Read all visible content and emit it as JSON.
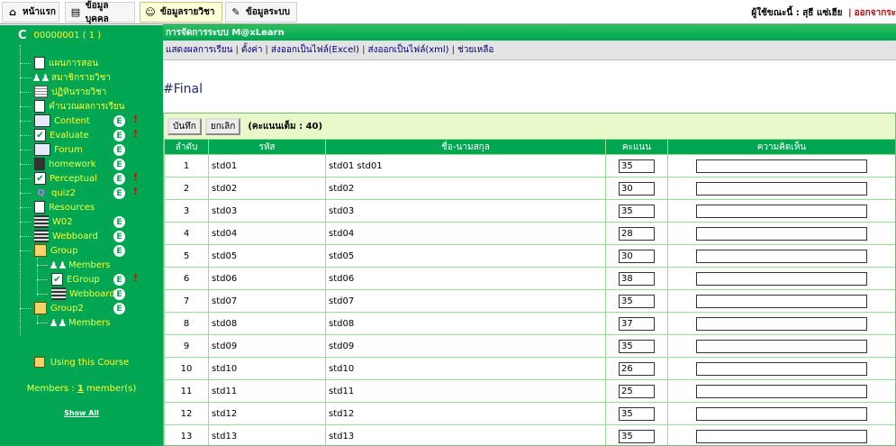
{
  "topbar": {
    "tabs": [
      {
        "label": "หน้าแรก",
        "icon": "home-icon"
      },
      {
        "label": "ข้อมูลบุคคล",
        "icon": "person-info-icon"
      },
      {
        "label": "ข้อมูลรายวิชา",
        "icon": "course-info-icon"
      },
      {
        "label": "ข้อมูลระบบ",
        "icon": "system-tools-icon"
      }
    ],
    "user_prefix": "ผู้ใช้ขณะนี้ : สุธี แซ่เฮีย",
    "separator": "|",
    "logout_label": "ออกจากระ"
  },
  "sidebar": {
    "course_icon": "C",
    "course_id": "00000001 ( 1 )",
    "items": [
      {
        "label": "แผนการสอน"
      },
      {
        "label": "สมาชิกรายวิชา"
      },
      {
        "label": "ปฏิทินรายวิชา"
      },
      {
        "label": "คำนวณผลการเรียน"
      },
      {
        "label": "Content"
      },
      {
        "label": "Evaluate"
      },
      {
        "label": "Forum"
      },
      {
        "label": "homework"
      },
      {
        "label": "Perceptual"
      },
      {
        "label": "quiz2"
      },
      {
        "label": "Resources"
      },
      {
        "label": "W02"
      },
      {
        "label": "Webboard"
      },
      {
        "label": "Group"
      },
      {
        "label": "Members"
      },
      {
        "label": "EGroup"
      },
      {
        "label": "Webboard"
      },
      {
        "label": "Group2"
      },
      {
        "label": "Members"
      }
    ],
    "badge_e": "E",
    "badge_excl": "!",
    "using_course": "Using this Course",
    "members_prefix": "Members : ",
    "members_count": "1",
    "members_suffix": " member(s)",
    "show_all": "Show All"
  },
  "main": {
    "title": "การจัดการระบบ M@xLearn",
    "menu": [
      "แสดงผลการเรียน",
      "ตั้งค่า",
      "ส่งออกเป็นไฟล์(Excel)",
      "ส่งออกเป็นไฟล์(xml)",
      "ช่วยเหลือ"
    ],
    "menu_sep": "|",
    "page_title": "#Final",
    "save_label": "บันทึก",
    "cancel_label": "ยกเลิก",
    "full_score": "(คะแนนเต็ม : 40)",
    "columns": [
      "ลำดับ",
      "รหัส",
      "ชื่อ-นามสกุล",
      "คะแนน",
      "ความคิดเห็น"
    ],
    "rows": [
      {
        "no": "1",
        "id": "std01",
        "name": "std01 std01",
        "score": "35"
      },
      {
        "no": "2",
        "id": "std02",
        "name": "std02",
        "score": "30"
      },
      {
        "no": "3",
        "id": "std03",
        "name": "std03",
        "score": "35"
      },
      {
        "no": "4",
        "id": "std04",
        "name": "std04",
        "score": "28"
      },
      {
        "no": "5",
        "id": "std05",
        "name": "std05",
        "score": "30"
      },
      {
        "no": "6",
        "id": "std06",
        "name": "std06",
        "score": "38"
      },
      {
        "no": "7",
        "id": "std07",
        "name": "std07",
        "score": "35"
      },
      {
        "no": "8",
        "id": "std08",
        "name": "std08",
        "score": "37"
      },
      {
        "no": "9",
        "id": "std09",
        "name": "std09",
        "score": "35"
      },
      {
        "no": "10",
        "id": "std10",
        "name": "std10",
        "score": "26"
      },
      {
        "no": "11",
        "id": "std11",
        "name": "std11",
        "score": "25"
      },
      {
        "no": "12",
        "id": "std12",
        "name": "std12",
        "score": "35"
      },
      {
        "no": "13",
        "id": "std13",
        "name": "std13",
        "score": "35"
      }
    ]
  },
  "colors": {
    "sidebar_bg": "#00a651",
    "sidebar_text": "#ffff33",
    "header_green": "#00a651",
    "logout_red": "#cc0000",
    "page_title_blue": "#1c2c6e"
  }
}
